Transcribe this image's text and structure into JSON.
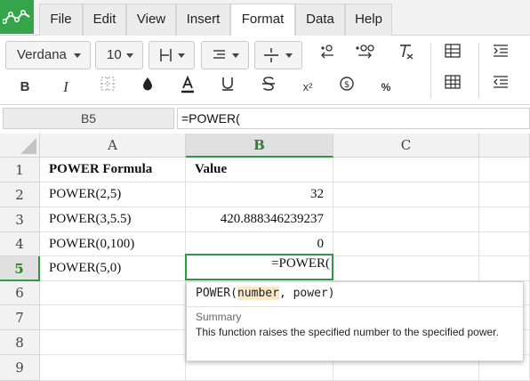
{
  "menu": {
    "tabs": [
      "File",
      "Edit",
      "View",
      "Insert",
      "Format",
      "Data",
      "Help"
    ],
    "active": "Format"
  },
  "toolbar": {
    "font_family": "Verdana",
    "font_size": "10",
    "bold": "B",
    "italic": "I",
    "superscript": "x²",
    "percent": "%"
  },
  "formula_bar": {
    "name_box": "B5",
    "content": "=POWER("
  },
  "columns": [
    "A",
    "B",
    "C"
  ],
  "rows": [
    "1",
    "2",
    "3",
    "4",
    "5",
    "6",
    "7",
    "8",
    "9"
  ],
  "cells": {
    "A1": "POWER Formula",
    "B1": "Value",
    "A2": "POWER(2,5)",
    "B2": "32",
    "A3": "POWER(3,5.5)",
    "B3": "420.888346239237",
    "A4": "POWER(0,100)",
    "B4": "0",
    "A5": "POWER(5,0)",
    "B5": "=POWER("
  },
  "tooltip": {
    "fn": "POWER(",
    "arg1": "number",
    "sep": ", power)",
    "summary_label": "Summary",
    "description": "This function raises the specified number to the specified power."
  },
  "colors": {
    "accent": "#2e9a44",
    "logo": "#36a44a"
  }
}
